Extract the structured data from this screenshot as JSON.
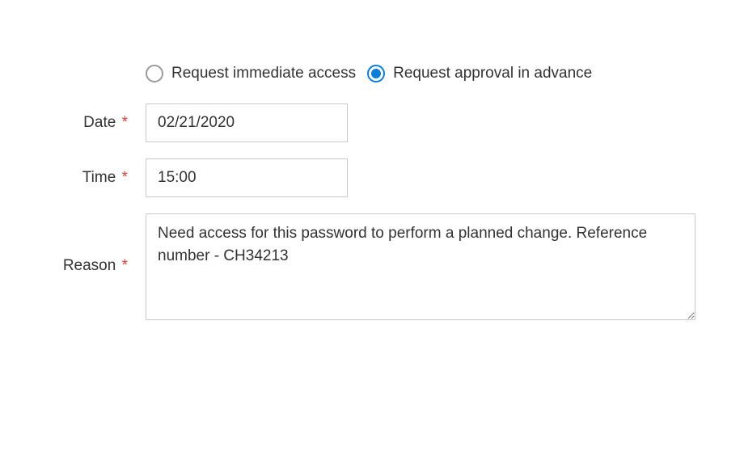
{
  "radios": {
    "immediate": {
      "label": "Request immediate access",
      "selected": false
    },
    "advance": {
      "label": "Request approval in advance",
      "selected": true
    }
  },
  "fields": {
    "date": {
      "label": "Date",
      "required_marker": "*",
      "value": "02/21/2020"
    },
    "time": {
      "label": "Time",
      "required_marker": "*",
      "value": "15:00"
    },
    "reason": {
      "label": "Reason",
      "required_marker": "*",
      "value": "Need access for this password to perform a planned change. Reference number - CH34213"
    }
  }
}
